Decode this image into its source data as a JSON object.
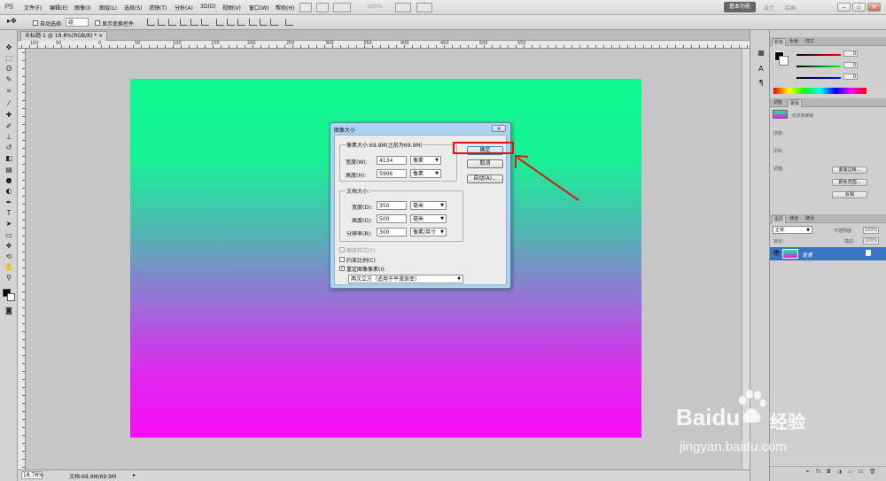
{
  "app": {
    "logo": "PS"
  },
  "menubar": {
    "items": [
      "文件(F)",
      "编辑(E)",
      "图像(I)",
      "图层(L)",
      "选择(S)",
      "滤镜(T)",
      "分析(A)",
      "3D(D)",
      "视图(V)",
      "窗口(W)",
      "帮助(H)"
    ],
    "zoom": "100%",
    "workspace_button": "基本功能",
    "workspace_tabs": [
      "设计",
      "绘画"
    ]
  },
  "options": {
    "auto_select_label": "自动选择:",
    "auto_select_value": "组",
    "show_transform_label": "显示变换控件"
  },
  "document": {
    "tab_title": "未标题-1 @ 18.8%(RGB/8) *",
    "ruler_numbers": [
      "100",
      "50",
      "0",
      "50",
      "100",
      "150",
      "200",
      "250",
      "300",
      "350",
      "400",
      "450",
      "500",
      "550"
    ],
    "status_zoom": "18.78%",
    "status_doc": "文档:69.9M/69.9M"
  },
  "canvas": {
    "colors": {
      "top": "#10fa90",
      "bottom": "#f70cf6"
    }
  },
  "dialog": {
    "title": "图像大小",
    "pixel_group_title": "像素大小:69.8M(之前为69.9M)",
    "width_label": "宽度(W):",
    "width_value": "4134",
    "height_label": "高度(H):",
    "height_value": "5906",
    "pixel_unit": "像素",
    "doc_group_title": "文档大小:",
    "doc_width_label": "宽度(D):",
    "doc_width_value": "350",
    "doc_height_label": "高度(G):",
    "doc_height_value": "500",
    "mm_unit": "毫米",
    "resolution_label": "分辨率(R):",
    "resolution_value": "300",
    "resolution_unit": "像素/英寸",
    "scale_styles_label": "缩放样式(Y)",
    "constrain_label": "约束比例(C)",
    "resample_label": "重定图像像素(I):",
    "resample_method": "两次立方（适用于平滑渐变）",
    "ok_button": "确定",
    "cancel_button": "取消",
    "auto_button": "自动(A)...",
    "close_icon": "close-icon"
  },
  "panels": {
    "color_tabs": [
      "颜色",
      "色板",
      "样式"
    ],
    "color_values": [
      "0",
      "0",
      "0"
    ],
    "adjust_tabs": [
      "调整",
      "蒙版"
    ],
    "mask_label": "无选择蒙版",
    "density_label": "浓度:",
    "feather_label": "羽化:",
    "refine_label": "调整:",
    "mask_edge_button": "蒙版边缘...",
    "color_range_button": "颜色范围...",
    "invert_button": "反相",
    "layer_tabs": [
      "图层",
      "通道",
      "路径"
    ],
    "blend_mode": "正常",
    "opacity_label": "不透明度:",
    "opacity_value": "100%",
    "lock_label": "锁定:",
    "fill_label": "填充:",
    "fill_value": "100%",
    "layer_name": "背景"
  },
  "watermark": {
    "brand": "Baidu",
    "brand_cn": "经验",
    "url": "jingyan.baidu.com"
  }
}
